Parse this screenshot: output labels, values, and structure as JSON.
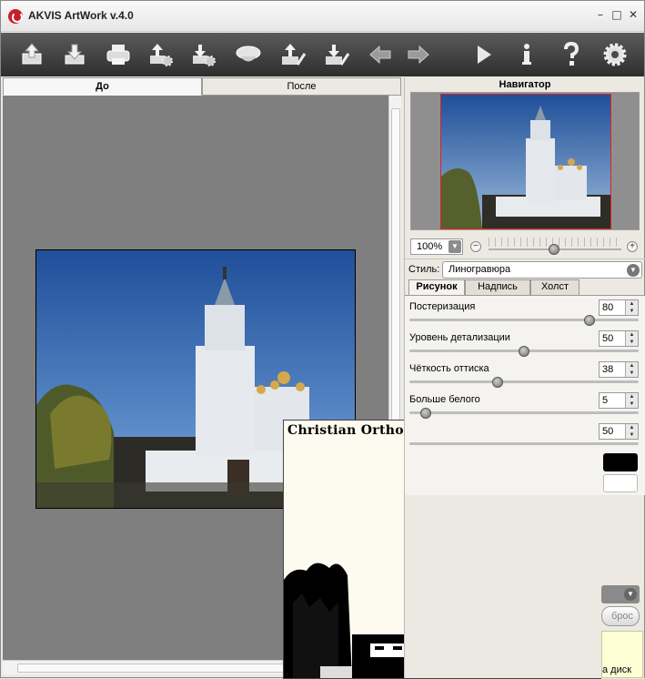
{
  "window": {
    "title": "AKVIS ArtWork v.4.0",
    "minimize": "–",
    "maximize": "□",
    "close": "✕"
  },
  "toolbar": {
    "buttons": [
      {
        "icon": "open-image-icon"
      },
      {
        "icon": "save-image-icon"
      },
      {
        "icon": "print-icon"
      },
      {
        "icon": "import-preset-icon"
      },
      {
        "icon": "export-preset-icon"
      },
      {
        "icon": "ink-bottle-icon"
      },
      {
        "icon": "load-strokes-icon"
      },
      {
        "icon": "save-strokes-icon"
      },
      {
        "icon": "undo-icon"
      },
      {
        "icon": "redo-icon"
      },
      {
        "icon": "run-icon"
      },
      {
        "icon": "info-icon"
      },
      {
        "icon": "help-icon"
      },
      {
        "icon": "settings-icon"
      }
    ]
  },
  "view_tabs": {
    "before": "До",
    "after": "После"
  },
  "result": {
    "caption": "Christian Orthodox Church"
  },
  "navigator": {
    "title": "Навигатор",
    "zoom_value": "100%",
    "zoom_out": "−",
    "zoom_in": "+"
  },
  "style": {
    "label": "Стиль:",
    "value": "Линогравюра"
  },
  "param_tabs": {
    "drawing": "Рисунок",
    "text": "Надпись",
    "canvas": "Холст"
  },
  "params": [
    {
      "label": "Постеризация",
      "value": "80",
      "fraction": 0.8
    },
    {
      "label": "Уровень детализации",
      "value": "50",
      "fraction": 0.5
    },
    {
      "label": "Чёткость оттиска",
      "value": "38",
      "fraction": 0.38
    },
    {
      "label": "Больше белого",
      "value": "5",
      "fraction": 0.05
    },
    {
      "label": "",
      "value": "50",
      "fraction": 0.5
    }
  ],
  "bottom": {
    "reset_label": "брос",
    "tip_text": "а диск"
  },
  "colors": {
    "toolbar_top": "#5b5b5b",
    "toolbar_bottom": "#2e2e2e",
    "canvas_bg": "#7f7f7f",
    "logo_red": "#c8202a",
    "paper": "#fdfbef",
    "tip_bg": "#ffffd6"
  }
}
